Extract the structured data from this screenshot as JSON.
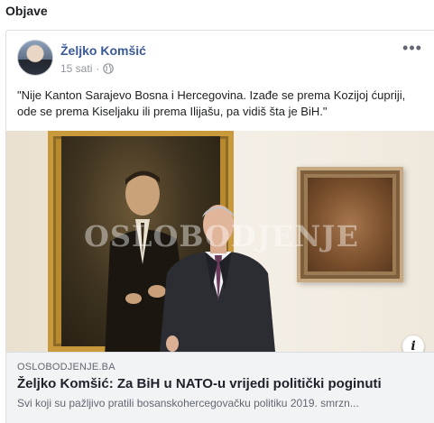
{
  "section": {
    "title": "Objave"
  },
  "post": {
    "author": "Željko Komšić",
    "time": "15 sati",
    "privacy_icon": "globe-icon",
    "more_icon": "more-options-icon",
    "more_label": "•••",
    "text": "\"Nije Kanton Sarajevo Bosna i Hercegovina. Izađe se prema Kozijoj ćupriji, ode se prema Kiseljaku ili prema Ilijašu, pa vidiš šta je BiH.\""
  },
  "image": {
    "watermark": "OSLOBODJENJE",
    "info_label": "i"
  },
  "link": {
    "domain": "OSLOBODJENJE.BA",
    "title": "Željko Komšić: Za BiH u NATO-u vrijedi politički poginuti",
    "description": "Svi koji su pažljivo pratili bosanskohercegovačku politiku 2019. smrzn..."
  },
  "colors": {
    "author_link": "#385898",
    "meta_text": "#90949c",
    "preview_bg": "#f2f3f5"
  }
}
